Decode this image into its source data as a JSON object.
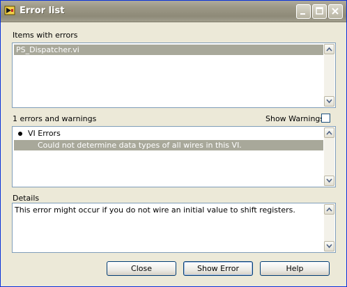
{
  "window": {
    "title": "Error list"
  },
  "items_section": {
    "label": "Items with errors",
    "items": [
      "PS_Dispatcher.vi"
    ]
  },
  "errors_section": {
    "count_label": "1 errors and warnings",
    "show_warnings_label": "Show Warnings",
    "group_label": "VI Errors",
    "error_message": "Could not determine data types of all wires in this VI."
  },
  "details_section": {
    "label": "Details",
    "text": "This error might occur if you do not wire an initial value to shift registers."
  },
  "buttons": {
    "close": "Close",
    "show_error": "Show Error",
    "help": "Help"
  }
}
